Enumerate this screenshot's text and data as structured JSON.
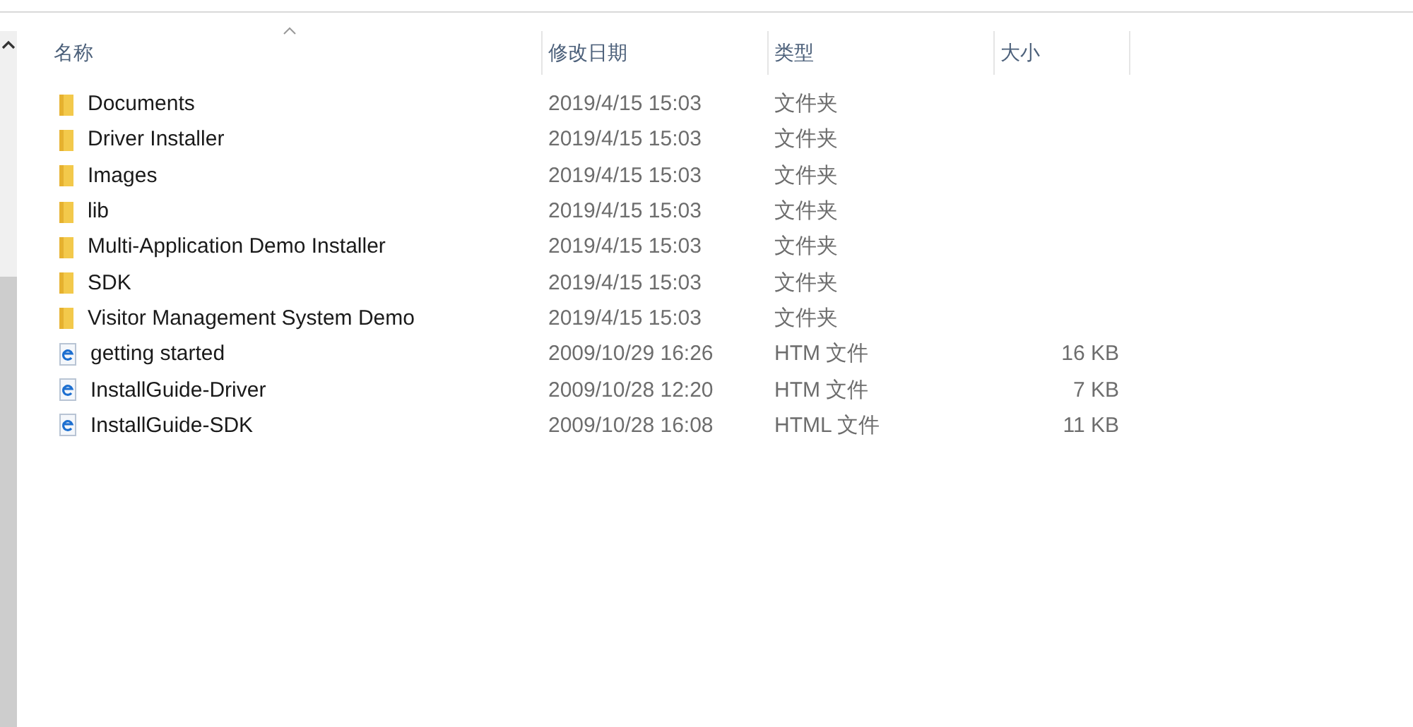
{
  "columns": [
    {
      "label": "名称",
      "sorted": true
    },
    {
      "label": "修改日期",
      "sorted": false
    },
    {
      "label": "类型",
      "sorted": false
    },
    {
      "label": "大小",
      "sorted": false
    }
  ],
  "rows": [
    {
      "kind": "folder",
      "name": "Documents",
      "date": "2019/4/15 15:03",
      "type": "文件夹"
    },
    {
      "kind": "folder",
      "name": "Driver Installer",
      "date": "2019/4/15 15:03",
      "type": "文件夹"
    },
    {
      "kind": "folder",
      "name": "Images",
      "date": "2019/4/15 15:03",
      "type": "文件夹"
    },
    {
      "kind": "folder",
      "name": "lib",
      "date": "2019/4/15 15:03",
      "type": "文件夹"
    },
    {
      "kind": "folder",
      "name": "Multi-Application Demo Installer",
      "date": "2019/4/15 15:03",
      "type": "文件夹"
    },
    {
      "kind": "folder",
      "name": "SDK",
      "date": "2019/4/15 15:03",
      "type": "文件夹"
    },
    {
      "kind": "folder",
      "name": "Visitor Management System Demo",
      "date": "2019/4/15 15:03",
      "type": "文件夹"
    },
    {
      "kind": "html",
      "name": "getting started",
      "date": "2009/10/29 16:26",
      "type": "HTM 文件",
      "size": "16 KB"
    },
    {
      "kind": "html",
      "name": "InstallGuide-Driver",
      "date": "2009/10/28 12:20",
      "type": "HTM 文件",
      "size": "7 KB"
    },
    {
      "kind": "html",
      "name": "InstallGuide-SDK",
      "date": "2009/10/28 16:08",
      "type": "HTML 文件",
      "size": "11 KB"
    }
  ]
}
